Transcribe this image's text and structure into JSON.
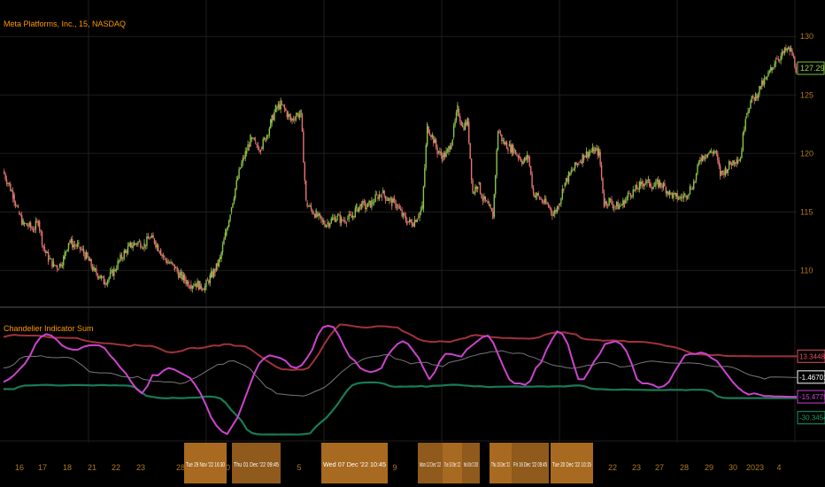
{
  "symbol_title": "Meta Platforms, Inc., 15, NASDAQ",
  "oscillator_title": "Chandelier Indicator Sum",
  "colors": {
    "background": "#000000",
    "grid": "#1e1e1e",
    "up_candle": "#8bc34a",
    "down_candle": "#e57373",
    "header_text": "#ff9800",
    "price_axis_text": "#b07a1a",
    "upper_band": "#a0323c",
    "lower_band": "#1a7a55",
    "oscillator": "#cc44cc",
    "midline": "#777777",
    "time_highlight": "#a86a20"
  },
  "price_axis": {
    "ticks": [
      "130",
      "125",
      "120",
      "115",
      "110"
    ],
    "last_price": "127.29"
  },
  "oscillator_axis": {
    "labels": [
      {
        "text": "13.34481",
        "color": "#e05060",
        "bg": "#000000"
      },
      {
        "text": "-1.46701601",
        "color": "#ffffff",
        "bg": "#000000"
      },
      {
        "text": "-15.47792614",
        "color": "#cc44cc",
        "bg": "#000000"
      },
      {
        "text": "-30.34544967",
        "color": "#1a9a65",
        "bg": "#000000"
      }
    ]
  },
  "time_axis": {
    "plain_labels": [
      "16",
      "17",
      "18",
      "21",
      "22",
      "23",
      "28",
      "30",
      "5",
      "6",
      "8",
      "9",
      "22",
      "23",
      "27",
      "28",
      "29",
      "30",
      "2023",
      "4"
    ],
    "highlight_labels": [
      "Tue 29 Nov '22  16:30",
      "Thu 01 Dec '22  09:45",
      "Wed 07 Dec '22  10:45",
      "Mon 12 Dec '22",
      "Tue 13 Dec '22",
      "Wed 14 Dec '22  10:00",
      "Thu 15 Dec '22",
      "Fri 16 Dec '22  09:45",
      "Tue 20 Dec '22  10:15"
    ]
  },
  "chart_data": [
    {
      "type": "candlestick",
      "title": "Meta Platforms, Inc., 15, NASDAQ",
      "ylim": [
        107,
        131
      ],
      "series": [
        {
          "name": "close",
          "values": [
            118.5,
            117.5,
            116.5,
            115,
            114,
            113.8,
            113.5,
            114.2,
            112,
            111,
            110.5,
            110.3,
            111,
            112.5,
            112.2,
            112,
            111.5,
            110.8,
            110,
            109.6,
            109,
            109.4,
            110,
            110.8,
            111.5,
            112,
            112.3,
            112.4,
            112.2,
            112.8,
            112.5,
            111.8,
            111,
            110.6,
            110.2,
            109.6,
            109.2,
            108.8,
            108.9,
            108.7,
            108.6,
            109.4,
            110,
            111,
            113,
            115,
            117,
            118.8,
            120,
            121.2,
            120.8,
            120.5,
            121.3,
            122.6,
            123.8,
            124.2,
            123.6,
            122.8,
            123.3,
            123.4,
            115.8,
            115.2,
            114.8,
            114.2,
            114,
            114.3,
            114.6,
            114.3,
            114.4,
            114.5,
            115.3,
            115.6,
            115.4,
            115.8,
            116.3,
            116.6,
            116.2,
            115.8,
            115.6,
            114.7,
            114.2,
            114,
            114.6,
            115.3,
            122.3,
            121.5,
            120.2,
            119.7,
            120.1,
            121.4,
            123.8,
            122.3,
            122.7,
            116.6,
            117.5,
            116.1,
            115.5,
            114.6,
            122,
            121,
            120.6,
            120.3,
            119.8,
            119.3,
            119.7,
            116.6,
            116.3,
            115.8,
            115.5,
            114.8,
            115.6,
            117.2,
            118.1,
            118.7,
            119.3,
            119.8,
            120.1,
            120.2,
            120.1,
            115.7,
            116,
            115.5,
            115.5,
            115.8,
            116.6,
            116.8,
            117.2,
            117.6,
            117.4,
            117.2,
            117.5,
            117.1,
            116.6,
            116.3,
            116.2,
            116.4,
            117,
            117.7,
            119.6,
            119.9,
            120.1,
            120.2,
            118.2,
            118.6,
            119.1,
            119.5,
            119.6,
            123.3,
            124.4,
            124.9,
            125.7,
            126.3,
            127.1,
            128.1,
            128.3,
            128.8,
            128.8,
            127.3
          ]
        }
      ],
      "price_ticks": [
        130,
        125,
        120,
        115,
        110
      ],
      "last_price": 127.29
    },
    {
      "type": "line",
      "title": "Chandelier Indicator Sum",
      "ylim": [
        -45,
        45
      ],
      "series": [
        {
          "name": "upper",
          "values": [
            27,
            28,
            28.6,
            28.2,
            28.1,
            28,
            28,
            27.9,
            27.2,
            26.6,
            26.5,
            26.5,
            26.4,
            26.4,
            26.3,
            24.9,
            24.1,
            23.5,
            23,
            22.6,
            22.5,
            22.1,
            21.6,
            21.2,
            20.3,
            21.5,
            20.9,
            20.6,
            20.8,
            19.8,
            18.2,
            16.5,
            16,
            16.4,
            17.2,
            18.7,
            19.4,
            18.9,
            19.3,
            20.2,
            21,
            20.8,
            21.9,
            21.9,
            20.8,
            20.7,
            20.3,
            18.4,
            15.7,
            13,
            10.4,
            8,
            5.6,
            4.1,
            3.9,
            3.5,
            3.9,
            3.8,
            5,
            9.6,
            15,
            21.6,
            27.2,
            32,
            35.9,
            35.6,
            35.1,
            34.5,
            34,
            33.7,
            34,
            34.6,
            34.7,
            34.5,
            34,
            33.8,
            31.2,
            29.6,
            27.7,
            25.4,
            24.2,
            23.7,
            23.5,
            24,
            23.7,
            23.5,
            24.7,
            25.6,
            26.4,
            27.9,
            28.4,
            27.8,
            27.6,
            26.9,
            26.7,
            26.3,
            26.3,
            26.1,
            25.9,
            25.9,
            25.8,
            26.1,
            26.8,
            28.5,
            29.5,
            30.2,
            30.3,
            30.2,
            29.4,
            28.8,
            26.2,
            25.3,
            25.1,
            24.9,
            24.4,
            24.5,
            24.6,
            24.3,
            24.3,
            23.6,
            23.6,
            23.6,
            23.5,
            23,
            22.4,
            21.9,
            20.8,
            20.2,
            19.5,
            18.3,
            16.9,
            15.5,
            14.7,
            14.6,
            14.2,
            14.1,
            14.4,
            13.8,
            13.5,
            13.5,
            13.4,
            13.5,
            13.4,
            13.3,
            13.3,
            13.3,
            13.3,
            13.3,
            13.3,
            13.3,
            13.3,
            13.3
          ]
        },
        {
          "name": "lower",
          "values": [
            -10,
            -10.1,
            -10,
            -8.4,
            -7.5,
            -7.5,
            -7.3,
            -7.1,
            -7,
            -7.2,
            -7.4,
            -7.5,
            -7.3,
            -7.2,
            -7.2,
            -7.2,
            -7.3,
            -7.5,
            -7.2,
            -7.2,
            -7.4,
            -7.3,
            -7.4,
            -7.4,
            -7.8,
            -9,
            -12.1,
            -14.8,
            -15.5,
            -16.1,
            -16.4,
            -16.6,
            -16.2,
            -16.4,
            -16.4,
            -16.2,
            -16.1,
            -16,
            -15.4,
            -15.3,
            -15.7,
            -16.6,
            -19.8,
            -24.6,
            -28.4,
            -32.5,
            -38.7,
            -41.2,
            -42.1,
            -42.3,
            -42.2,
            -42.2,
            -42.3,
            -42.2,
            -42.2,
            -42.3,
            -42.2,
            -42,
            -41.4,
            -37,
            -33.7,
            -30.6,
            -26.4,
            -21.7,
            -16.2,
            -10.9,
            -7.2,
            -5.9,
            -5.4,
            -5.3,
            -5.2,
            -5.5,
            -6.2,
            -7.8,
            -8.4,
            -8.2,
            -8.3,
            -8.1,
            -8.2,
            -7.8,
            -8.4,
            -7.8,
            -7.6,
            -7.5,
            -7.1,
            -6.9,
            -7,
            -7.4,
            -7.7,
            -8.1,
            -7.9,
            -8.3,
            -8.6,
            -8.4,
            -8.3,
            -8.3,
            -8.2,
            -8.1,
            -8.4,
            -8.2,
            -8.3,
            -8.1,
            -8.1,
            -8.3,
            -8.1,
            -8,
            -8.2,
            -7.8,
            -7.5,
            -7.4,
            -8.1,
            -9.5,
            -10.1,
            -10.1,
            -10.3,
            -10.5,
            -10.5,
            -10.3,
            -10.3,
            -10.5,
            -10.5,
            -10.6,
            -10.7,
            -10.7,
            -10.7,
            -10.7,
            -10.5,
            -10.6,
            -10.5,
            -10.8,
            -10.5,
            -10.5,
            -10.5,
            -10.8,
            -12,
            -15.1,
            -16.2,
            -16.4,
            -16.4,
            -16.4,
            -16.4,
            -16.4,
            -16.4,
            -16.4,
            -16.4,
            -16.4,
            -16.4,
            -16.4,
            -16.4,
            -16.4,
            -16.4
          ]
        },
        {
          "name": "middle",
          "values": [
            5,
            5.6,
            7.7,
            11.6,
            13.2,
            13.2,
            13.2,
            13.7,
            12.7,
            12.4,
            12.3,
            12.5,
            12.5,
            11.4,
            8.7,
            5.9,
            2.4,
            1.8,
            1.5,
            1.5,
            1.3,
            0.3,
            -1,
            -1.4,
            -2.1,
            -1,
            -3,
            -3.5,
            -4.6,
            -4.5,
            -5,
            -4.9,
            -5.3,
            -6.2,
            -5.3,
            -3.2,
            -1.6,
            0.7,
            3.1,
            5.2,
            7.5,
            7.7,
            9.8,
            10.1,
            8.3,
            6.8,
            4.4,
            -0.2,
            -4.2,
            -8.6,
            -10.4,
            -13.4,
            -13.6,
            -14.1,
            -14.5,
            -14.6,
            -14.9,
            -13.7,
            -11.9,
            -10.4,
            -8.5,
            -5.4,
            -1.8,
            1.9,
            4.8,
            7.8,
            8.8,
            11.1,
            12.3,
            13,
            13.5,
            14.3,
            14.5,
            11.7,
            10.9,
            9.6,
            7.9,
            8.6,
            8.9,
            9,
            7.3,
            6.9,
            6,
            8.7,
            9.7,
            10.4,
            11.6,
            13.1,
            14,
            15.1,
            15.6,
            16.6,
            16.6,
            17.3,
            16.2,
            15.3,
            15.6,
            15.3,
            13.4,
            12.4,
            10.8,
            9.2,
            7.7,
            6.6,
            6.1,
            5.3,
            4.7,
            5.2,
            5.9,
            6.9,
            7.1,
            8.6,
            9,
            8.6,
            7.5,
            5.7,
            5.9,
            6.4,
            7.4,
            8.7,
            9.5,
            9.9,
            9.5,
            9.1,
            8.6,
            8.5,
            8.3,
            8.5,
            8.6,
            8.3,
            8,
            7.1,
            6.5,
            6,
            6,
            6.1,
            5.5,
            4,
            2.1,
            0.3,
            -0.7,
            -1.5,
            -2.9,
            -1.5,
            -1.4,
            -1.5,
            -1.6,
            -1.7,
            -1.8
          ]
        },
        {
          "name": "oscillator",
          "values": [
            -5,
            -3,
            0,
            4,
            8,
            14,
            22,
            27,
            29,
            28,
            25,
            21,
            19,
            18,
            18,
            20,
            21,
            21.3,
            21,
            19,
            14,
            10,
            5,
            1,
            -5,
            -10,
            -13,
            -8,
            0,
            -0.3,
            3,
            5,
            4,
            2,
            0,
            -2,
            -7,
            -13,
            -21,
            -30,
            -36,
            -40,
            -42,
            -36,
            -30,
            -20,
            -10,
            0,
            8,
            12,
            14,
            13,
            12,
            10,
            6,
            5,
            7,
            12,
            18,
            28,
            34,
            35,
            34,
            28,
            20,
            13,
            10,
            5,
            3,
            2,
            3,
            5,
            13,
            18,
            22,
            24,
            22,
            17,
            12,
            4,
            -3,
            2,
            10,
            15,
            15,
            14,
            13,
            18,
            21,
            24,
            27,
            28,
            23,
            14,
            5,
            -3,
            -6,
            -6,
            -7,
            -4,
            5,
            9,
            18,
            25,
            31,
            29,
            22,
            9,
            -3,
            -3,
            3,
            10,
            15,
            22,
            23,
            24,
            22,
            17,
            8,
            -3,
            -6,
            -6,
            -7,
            -9,
            -8,
            -5,
            2,
            8,
            14,
            15,
            15,
            16,
            15,
            12,
            10,
            5,
            0,
            -5,
            -9,
            -12,
            -14,
            -13,
            -14,
            -15,
            -15,
            -15.2,
            -15.3,
            -15.4,
            -15.5,
            -15.48
          ]
        }
      ]
    }
  ]
}
